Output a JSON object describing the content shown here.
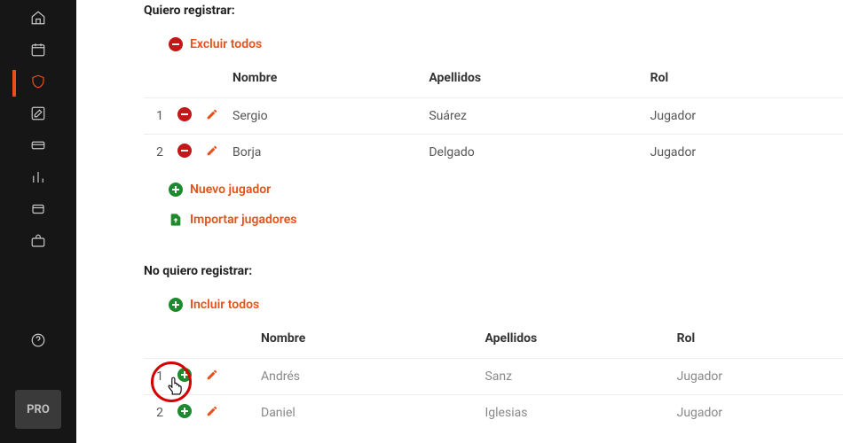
{
  "sidebar": {
    "items": [
      {
        "name": "home"
      },
      {
        "name": "calendar"
      },
      {
        "name": "shield",
        "active": true
      },
      {
        "name": "edit"
      },
      {
        "name": "card"
      },
      {
        "name": "stats"
      },
      {
        "name": "badge"
      },
      {
        "name": "briefcase"
      }
    ],
    "help": {
      "name": "help"
    },
    "pro_label": "PRO"
  },
  "register": {
    "title": "Quiero registrar:",
    "exclude_all": "Excluir todos",
    "new_player": "Nuevo jugador",
    "import_players": "Importar jugadores",
    "columns": {
      "name": "Nombre",
      "surname": "Apellidos",
      "role": "Rol"
    },
    "rows": [
      {
        "num": "1",
        "name": "Sergio",
        "surname": "Suárez",
        "role": "Jugador"
      },
      {
        "num": "2",
        "name": "Borja",
        "surname": "Delgado",
        "role": "Jugador"
      }
    ]
  },
  "unregister": {
    "title": "No quiero registrar:",
    "include_all": "Incluir todos",
    "columns": {
      "name": "Nombre",
      "surname": "Apellidos",
      "role": "Rol"
    },
    "rows": [
      {
        "num": "1",
        "name": "Andrés",
        "surname": "Sanz",
        "role": "Jugador"
      },
      {
        "num": "2",
        "name": "Daniel",
        "surname": "Iglesias",
        "role": "Jugador"
      }
    ]
  }
}
